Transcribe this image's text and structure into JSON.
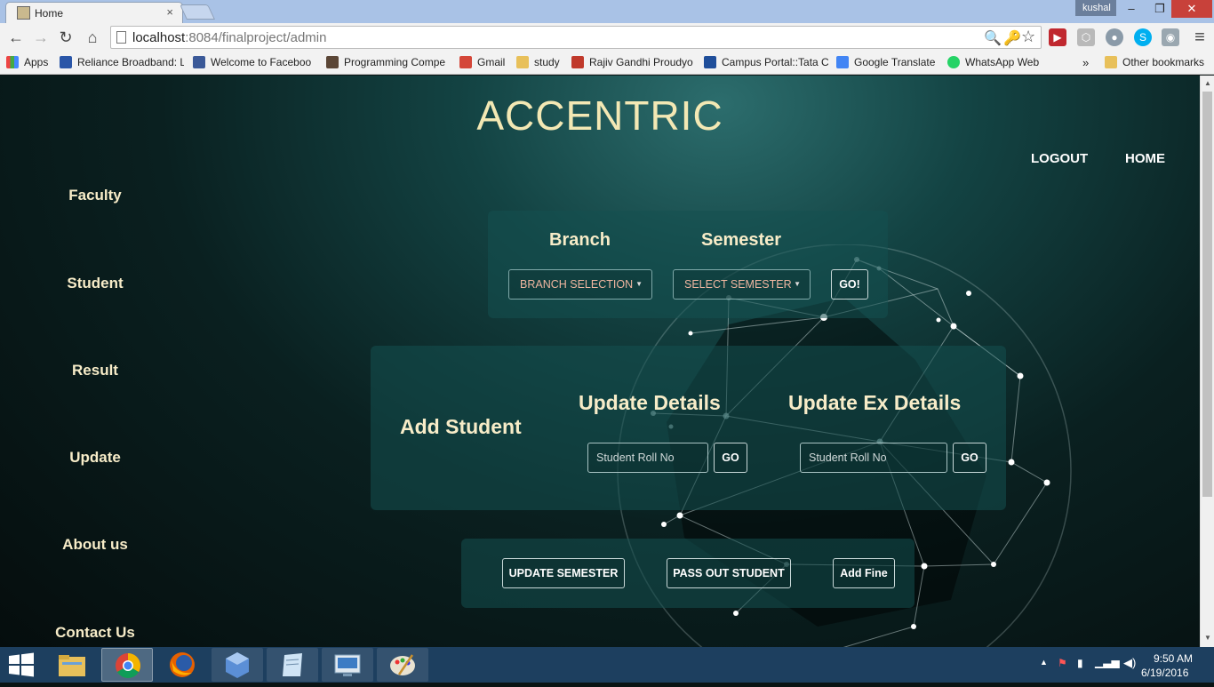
{
  "tab": {
    "title": "Home",
    "close": "×"
  },
  "window": {
    "user": "kushal",
    "minimize": "–",
    "maximize": "❐",
    "close": "✕"
  },
  "toolbar": {
    "back": "←",
    "forward": "→",
    "reload": "↻",
    "home": "⌂",
    "url_host": "localhost",
    "url_path": ":8084/finalproject/admin",
    "zoom_icon": "🔍",
    "key_icon": "🔑",
    "star_icon": "☆",
    "menu_icon": "≡"
  },
  "bookmarks": {
    "apps": "Apps",
    "items": [
      {
        "label": "Reliance Broadband: L",
        "icon": "reliance-icon",
        "color": "#2a56a8"
      },
      {
        "label": "Welcome to Faceboo",
        "icon": "facebook-icon",
        "color": "#3b5998"
      },
      {
        "label": "Programming Compe",
        "icon": "codechef-icon",
        "color": "#5b4636"
      },
      {
        "label": "Gmail",
        "icon": "gmail-icon",
        "color": "#d44638"
      },
      {
        "label": "study",
        "icon": "folder-icon",
        "color": "#e8c05a"
      },
      {
        "label": "Rajiv Gandhi Proudyo",
        "icon": "rgpv-icon",
        "color": "#c0392b"
      },
      {
        "label": "Campus Portal::Tata C",
        "icon": "tata-icon",
        "color": "#1f4e9a"
      },
      {
        "label": "Google Translate",
        "icon": "translate-icon",
        "color": "#4285f4"
      },
      {
        "label": "WhatsApp Web",
        "icon": "whatsapp-icon",
        "color": "#25d366"
      }
    ],
    "more": "»",
    "other": "Other bookmarks"
  },
  "site": {
    "title": "ACCENTRIC",
    "nav": {
      "logout": "LOGOUT",
      "home": "HOME"
    },
    "sidebar": [
      "Faculty",
      "Student",
      "Result",
      "Update",
      "About us",
      "Contact Us"
    ]
  },
  "branch_panel": {
    "branch_heading": "Branch",
    "semester_heading": "Semester",
    "branch_select": "BRANCH SELECTION",
    "semester_select": "SELECT SEMESTER",
    "go": "GO!"
  },
  "student_panel": {
    "add_student": "Add Student",
    "update_details": "Update Details",
    "update_ex_details": "Update Ex Details",
    "roll_placeholder": "Student Roll No",
    "go": "GO"
  },
  "actions": {
    "update_semester": "UPDATE SEMESTER",
    "pass_out": "PASS OUT STUDENT",
    "add_fine": "Add Fine"
  },
  "taskbar": {
    "clock_time": "9:50 AM",
    "clock_date": "6/19/2016",
    "apps": [
      "file-explorer-icon",
      "chrome-icon",
      "firefox-icon",
      "virtualbox-icon",
      "notepad-icon",
      "remote-desktop-icon",
      "paint-icon"
    ]
  },
  "colors": {
    "accent": "#f7ecc8",
    "title": "#f3e8b4",
    "select_text": "#f0b6a0"
  }
}
